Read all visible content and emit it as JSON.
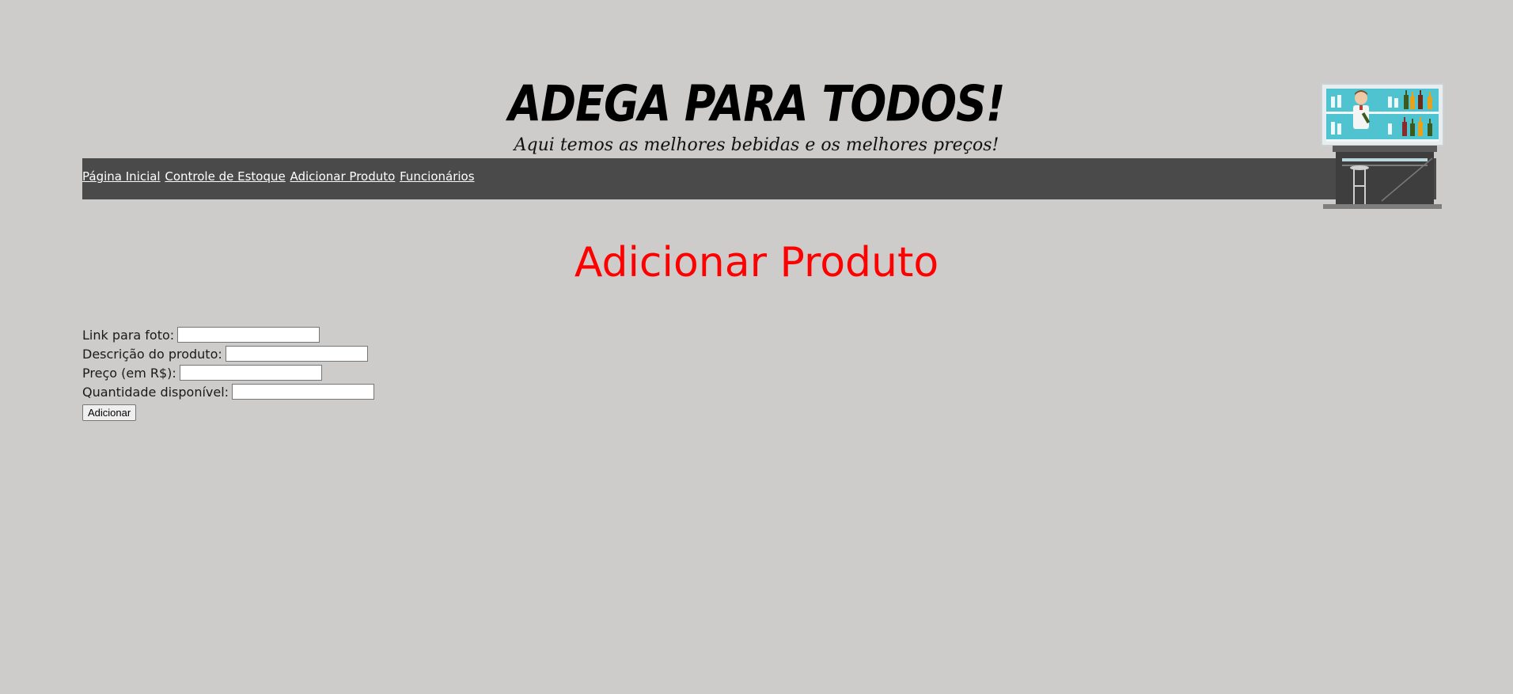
{
  "header": {
    "title": "ADEGA PARA TODOS!",
    "subtitle": "Aqui temos as melhores bebidas e os melhores preços!",
    "illustration_icon": "bartender-illustration"
  },
  "nav": {
    "items": [
      {
        "label": "Página Inicial"
      },
      {
        "label": "Controle de Estoque"
      },
      {
        "label": "Adicionar Produto"
      },
      {
        "label": "Funcionários"
      }
    ]
  },
  "main": {
    "heading": "Adicionar Produto",
    "form": {
      "photo_link_label": "Link para foto:",
      "photo_link_value": "",
      "description_label": "Descrição do produto:",
      "description_value": "",
      "price_label": "Preço (em R$):",
      "price_value": "",
      "quantity_label": "Quantidade disponível:",
      "quantity_value": "",
      "submit_label": "Adicionar"
    }
  },
  "colors": {
    "background": "#cdccca",
    "navbar": "#4b4a4a",
    "heading": "#fe0000"
  }
}
